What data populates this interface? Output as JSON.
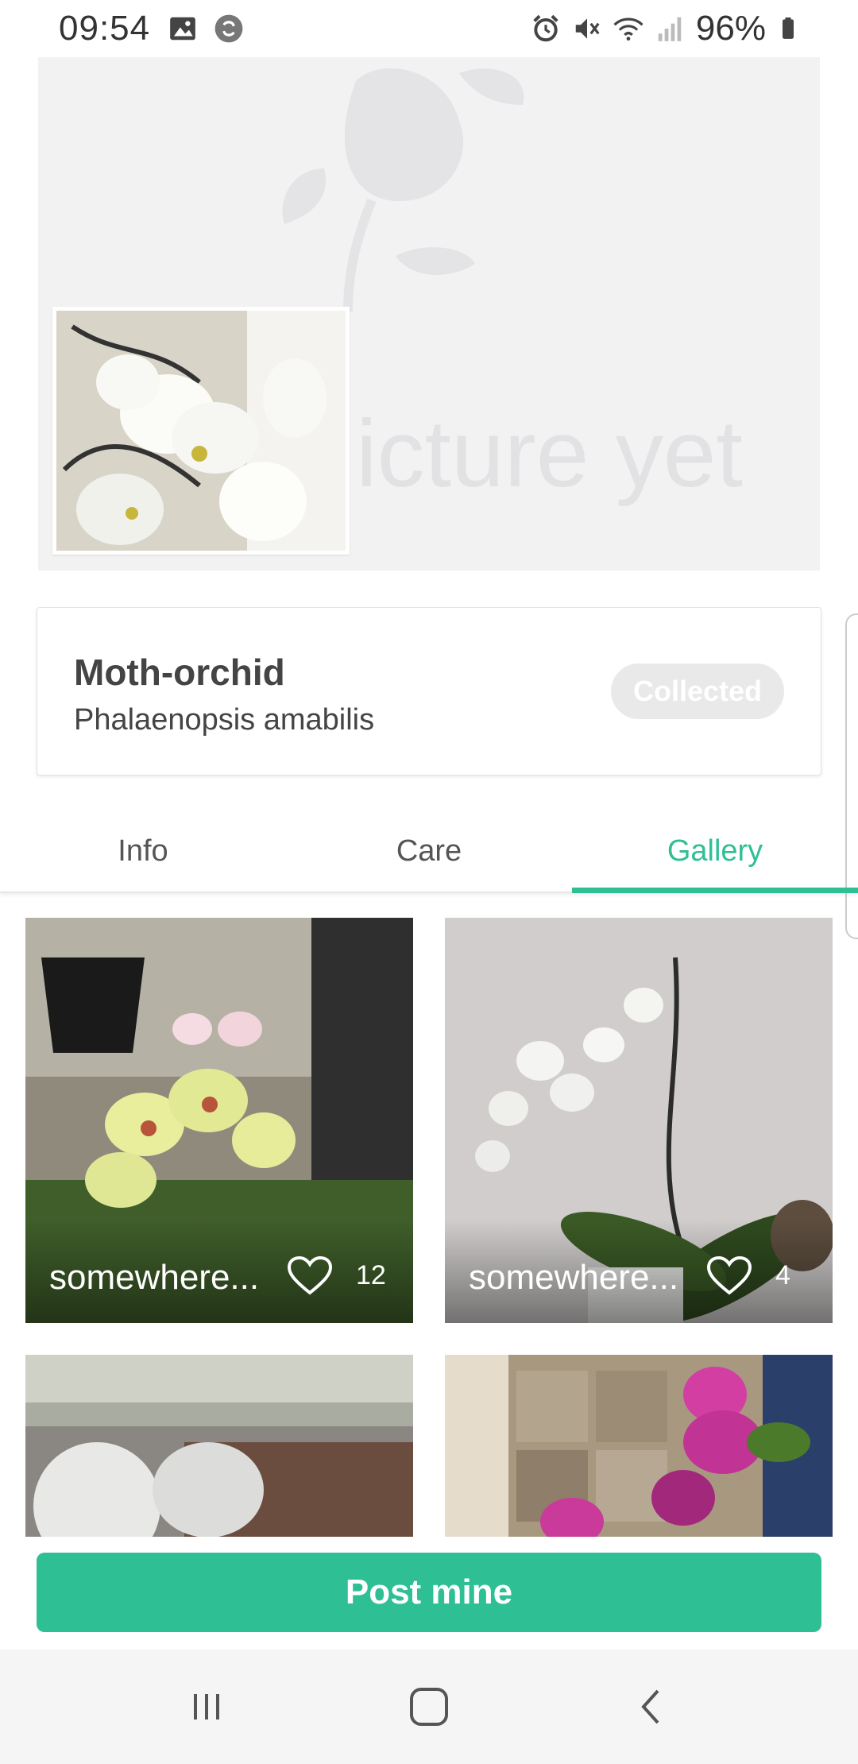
{
  "status_bar": {
    "time": "09:54",
    "battery": "96%",
    "icons": [
      "image-icon",
      "sync-icon",
      "alarm-icon",
      "mute-icon",
      "wifi-icon",
      "signal-icon",
      "battery-icon"
    ]
  },
  "hero": {
    "placeholder_text": "icture yet"
  },
  "plant": {
    "common_name": "Moth-orchid",
    "latin_name": "Phalaenopsis amabilis",
    "badge": "Collected"
  },
  "tabs": [
    {
      "label": "Info",
      "active": false
    },
    {
      "label": "Care",
      "active": false
    },
    {
      "label": "Gallery",
      "active": true
    }
  ],
  "gallery": [
    {
      "location": "somewhere...",
      "likes": "12"
    },
    {
      "location": "somewhere...",
      "likes": "4"
    },
    {
      "location": "",
      "likes": ""
    },
    {
      "location": "",
      "likes": ""
    }
  ],
  "action": {
    "post_label": "Post mine"
  },
  "colors": {
    "accent": "#2fbf95",
    "badge_bg": "#e9e9e9",
    "hero_bg": "#f2f2f3"
  }
}
